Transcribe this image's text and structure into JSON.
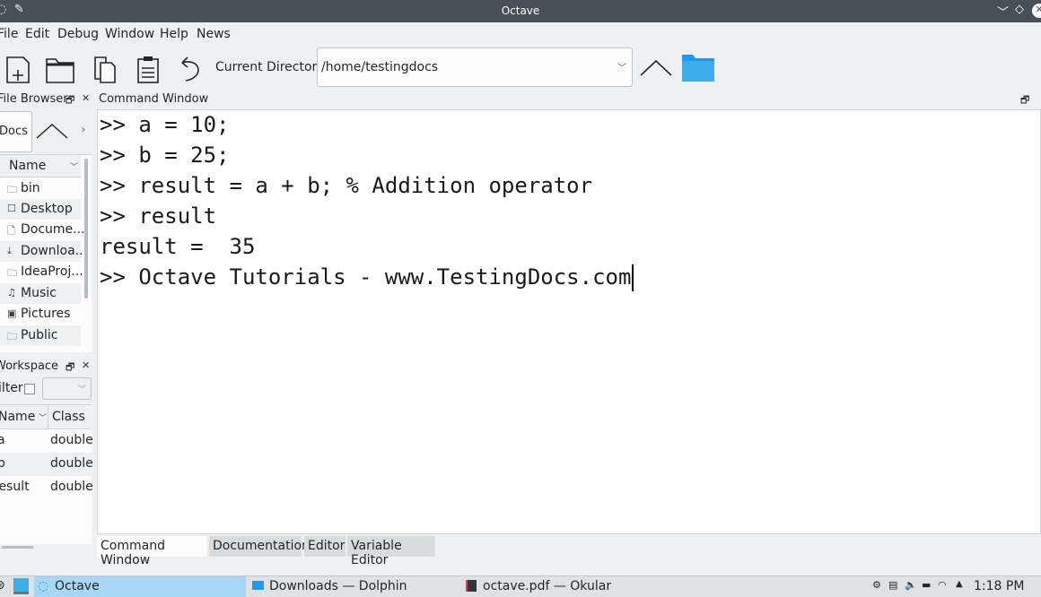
{
  "window": {
    "title": "Octave"
  },
  "menu": [
    "File",
    "Edit",
    "Debug",
    "Window",
    "Help",
    "News"
  ],
  "toolbar": {
    "current_dir_label": "Current Directory:",
    "current_dir_value": "/home/testingdocs"
  },
  "file_browser": {
    "title": "File Browser",
    "combo_value": "Docs",
    "column": "Name",
    "items": [
      {
        "label": "bin",
        "icon": "folder-icon"
      },
      {
        "label": "Desktop",
        "icon": "desktop-icon"
      },
      {
        "label": "Docume...",
        "icon": "documents-icon"
      },
      {
        "label": "Downloa...",
        "icon": "download-icon"
      },
      {
        "label": "IdeaProj...",
        "icon": "folder-icon"
      },
      {
        "label": "Music",
        "icon": "music-icon"
      },
      {
        "label": "Pictures",
        "icon": "pictures-icon"
      },
      {
        "label": "Public",
        "icon": "folder-icon"
      }
    ]
  },
  "workspace": {
    "title": "Workspace",
    "filter_label": "Filter",
    "columns": [
      "Name",
      "Class"
    ],
    "rows": [
      {
        "name": "a",
        "class": "double"
      },
      {
        "name": "b",
        "class": "double"
      },
      {
        "name": "result",
        "class": "double"
      }
    ]
  },
  "command_window": {
    "title": "Command Window",
    "lines": [
      ">> a = 10;",
      ">> b = 25;",
      ">> result = a + b; % Addition operator",
      ">> result",
      "result =  35",
      ">> Octave Tutorials - www.TestingDocs.com"
    ]
  },
  "bottom_tabs": [
    "Command Window",
    "Documentation",
    "Editor",
    "Variable Editor"
  ],
  "taskbar": {
    "tasks": [
      "Octave",
      "Downloads — Dolphin",
      "octave.pdf — Okular"
    ],
    "clock": "1:18 PM"
  },
  "colors": {
    "titlebar": "#475057",
    "folder_accent": "#1d99f3",
    "active_task": "#a8d6f5"
  }
}
